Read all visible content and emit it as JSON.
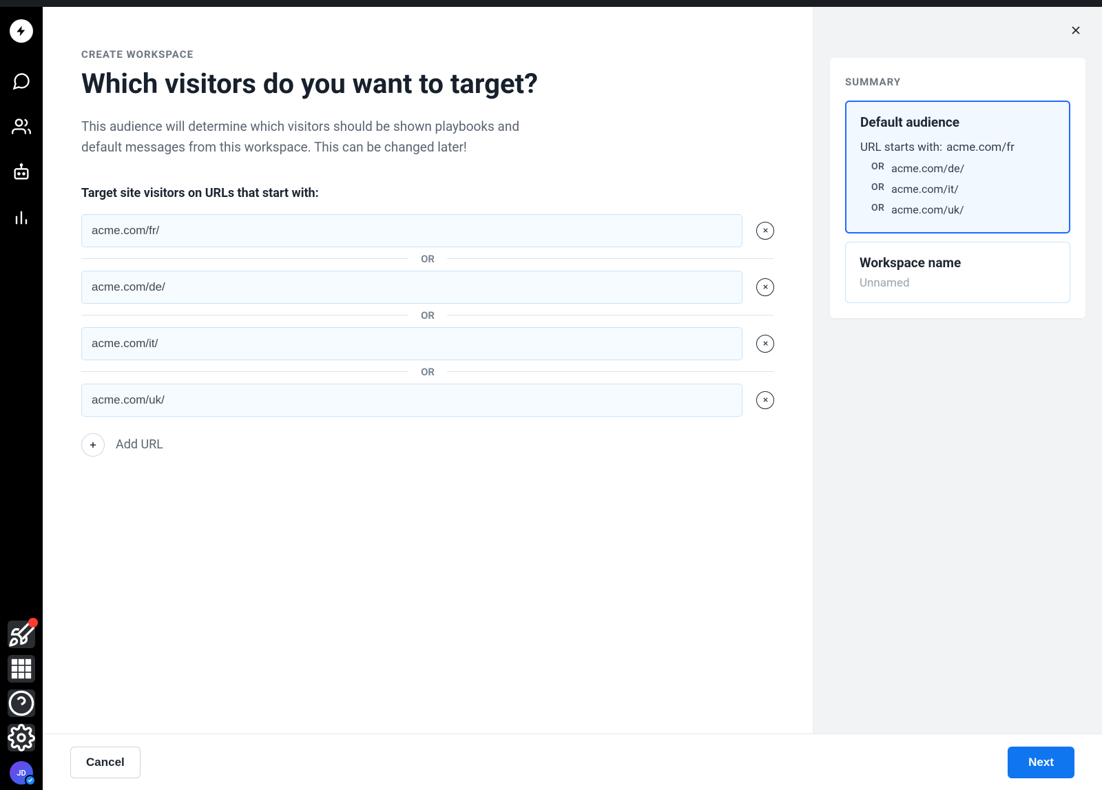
{
  "sidebar": {
    "avatar_initials": "JD"
  },
  "header": {
    "breadcrumb": "CREATE WORKSPACE",
    "title": "Which visitors do you want to target?"
  },
  "main": {
    "description": "This audience will determine which visitors should be shown playbooks and default messages from this workspace. This can be changed later!",
    "field_label": "Target site visitors on URLs that start with:",
    "urls": [
      "acme.com/fr/",
      "acme.com/de/",
      "acme.com/it/",
      "acme.com/uk/"
    ],
    "or_separator": "OR",
    "add_url_label": "Add URL"
  },
  "summary": {
    "title": "SUMMARY",
    "audience": {
      "heading": "Default audience",
      "prefix_label": "URL starts with:",
      "first_value": "acme.com/fr",
      "or_label": "OR",
      "rest": [
        "acme.com/de/",
        "acme.com/it/",
        "acme.com/uk/"
      ]
    },
    "workspace": {
      "label": "Workspace name",
      "value": "Unnamed"
    }
  },
  "footer": {
    "cancel_label": "Cancel",
    "next_label": "Next"
  }
}
